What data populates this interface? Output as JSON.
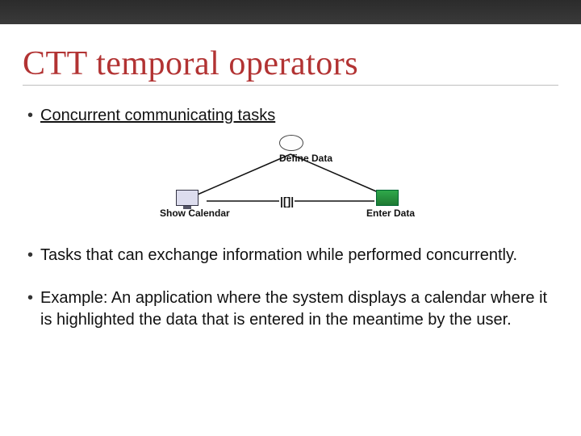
{
  "title": "CTT temporal operators",
  "bullets": {
    "b1": "Concurrent communicating tasks",
    "b2": "Tasks that can exchange information while performed concurrently.",
    "b3": "Example: An application where the system displays a calendar where it is highlighted the data that is entered in the meantime by the user."
  },
  "diagram": {
    "root": "Define Data",
    "left": "Show Calendar",
    "right": "Enter Data",
    "operator": "|[]|"
  },
  "chart_data": {
    "type": "tree",
    "nodes": [
      {
        "id": "root",
        "label": "Define Data",
        "kind": "abstraction"
      },
      {
        "id": "left",
        "label": "Show Calendar",
        "kind": "system-task"
      },
      {
        "id": "right",
        "label": "Enter Data",
        "kind": "interaction-task"
      }
    ],
    "edges": [
      {
        "from": "root",
        "to": "left"
      },
      {
        "from": "root",
        "to": "right"
      }
    ],
    "sibling_operator": {
      "between": [
        "left",
        "right"
      ],
      "symbol": "|[]|",
      "name": "concurrent-communicating"
    }
  }
}
